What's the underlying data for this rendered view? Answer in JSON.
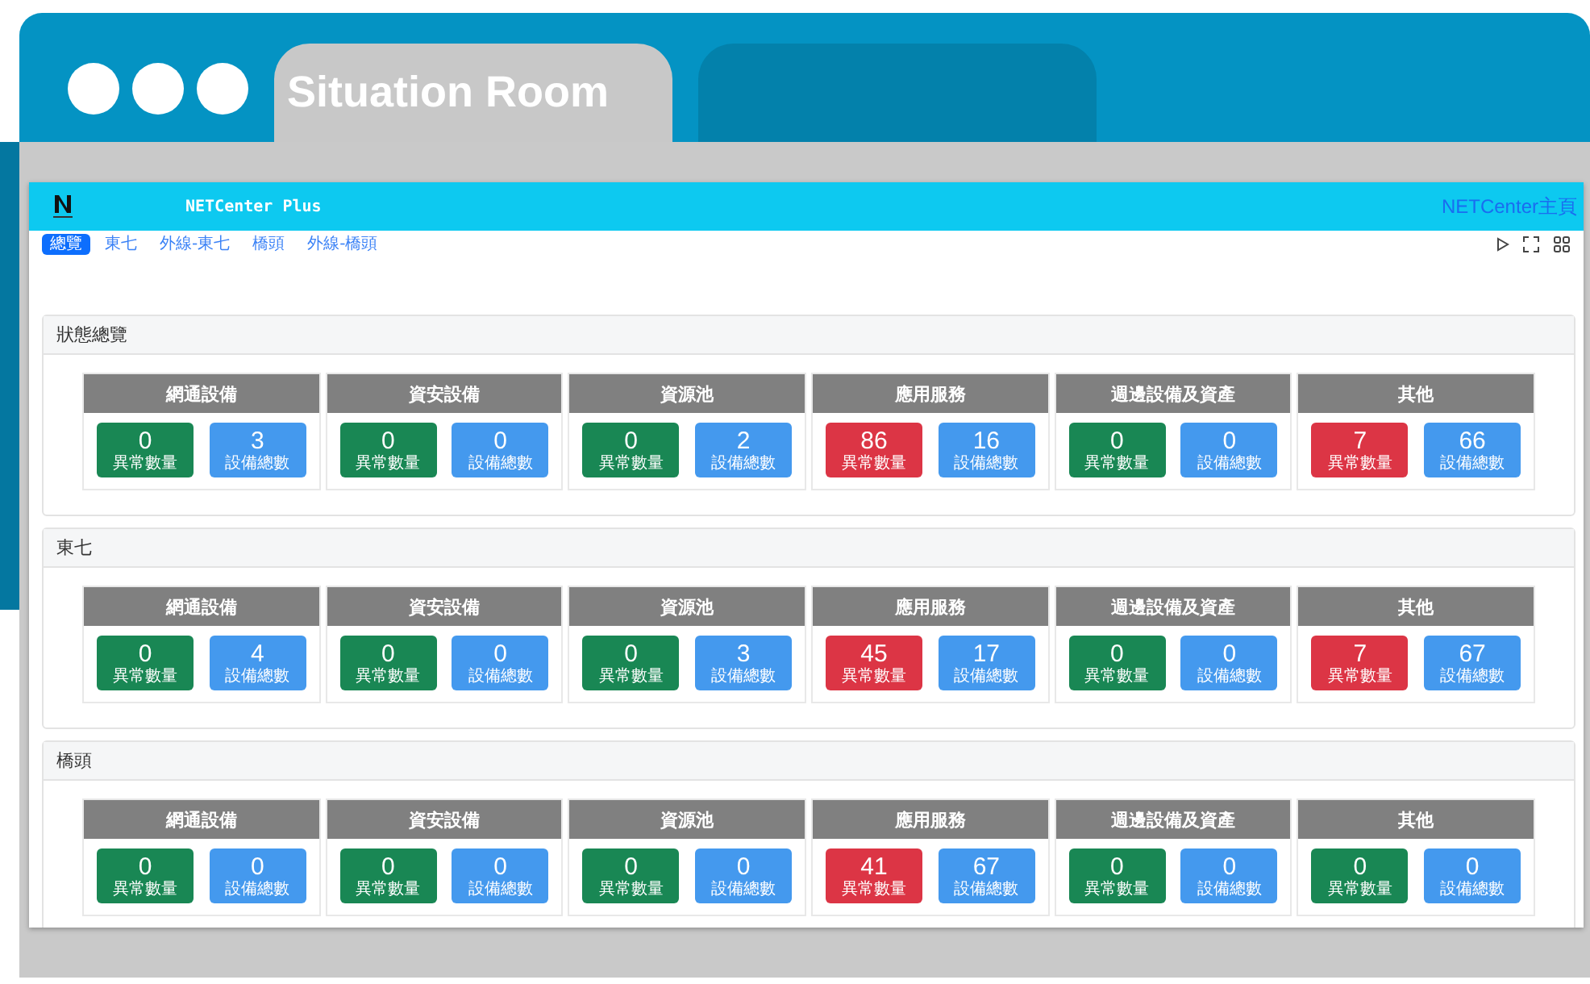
{
  "window": {
    "tabs": [
      {
        "label": "Situation Room",
        "selected": true
      },
      {
        "selected": false
      }
    ]
  },
  "app": {
    "title": "NETCenter Plus",
    "home_link": "NETCenter主頁"
  },
  "nav": [
    {
      "label": "總覽",
      "selected": true
    },
    {
      "label": "東七",
      "selected": false
    },
    {
      "label": "外線-東七",
      "selected": false
    },
    {
      "label": "橋頭",
      "selected": false
    },
    {
      "label": "外線-橋頭",
      "selected": false
    }
  ],
  "sections": [
    {
      "title": "狀態總覽",
      "groups": [
        {
          "name": "網通設備",
          "anomaly": "0",
          "alert": false,
          "anomaly_label": "異常數量",
          "total": "3",
          "total_label": "設備總數"
        },
        {
          "name": "資安設備",
          "anomaly": "0",
          "alert": false,
          "anomaly_label": "異常數量",
          "total": "0",
          "total_label": "設備總數"
        },
        {
          "name": "資源池",
          "anomaly": "0",
          "alert": false,
          "anomaly_label": "異常數量",
          "total": "2",
          "total_label": "設備總數"
        },
        {
          "name": "應用服務",
          "anomaly": "86",
          "alert": true,
          "anomaly_label": "異常數量",
          "total": "16",
          "total_label": "設備總數"
        },
        {
          "name": "週邊設備及資產",
          "anomaly": "0",
          "alert": false,
          "anomaly_label": "異常數量",
          "total": "0",
          "total_label": "設備總數"
        },
        {
          "name": "其他",
          "anomaly": "7",
          "alert": true,
          "anomaly_label": "異常數量",
          "total": "66",
          "total_label": "設備總數"
        }
      ]
    },
    {
      "title": "東七",
      "groups": [
        {
          "name": "網通設備",
          "anomaly": "0",
          "alert": false,
          "anomaly_label": "異常數量",
          "total": "4",
          "total_label": "設備總數"
        },
        {
          "name": "資安設備",
          "anomaly": "0",
          "alert": false,
          "anomaly_label": "異常數量",
          "total": "0",
          "total_label": "設備總數"
        },
        {
          "name": "資源池",
          "anomaly": "0",
          "alert": false,
          "anomaly_label": "異常數量",
          "total": "3",
          "total_label": "設備總數"
        },
        {
          "name": "應用服務",
          "anomaly": "45",
          "alert": true,
          "anomaly_label": "異常數量",
          "total": "17",
          "total_label": "設備總數"
        },
        {
          "name": "週邊設備及資產",
          "anomaly": "0",
          "alert": false,
          "anomaly_label": "異常數量",
          "total": "0",
          "total_label": "設備總數"
        },
        {
          "name": "其他",
          "anomaly": "7",
          "alert": true,
          "anomaly_label": "異常數量",
          "total": "67",
          "total_label": "設備總數"
        }
      ]
    },
    {
      "title": "橋頭",
      "groups": [
        {
          "name": "網通設備",
          "anomaly": "0",
          "alert": false,
          "anomaly_label": "異常數量",
          "total": "0",
          "total_label": "設備總數"
        },
        {
          "name": "資安設備",
          "anomaly": "0",
          "alert": false,
          "anomaly_label": "異常數量",
          "total": "0",
          "total_label": "設備總數"
        },
        {
          "name": "資源池",
          "anomaly": "0",
          "alert": false,
          "anomaly_label": "異常數量",
          "total": "0",
          "total_label": "設備總數"
        },
        {
          "name": "應用服務",
          "anomaly": "41",
          "alert": true,
          "anomaly_label": "異常數量",
          "total": "67",
          "total_label": "設備總數"
        },
        {
          "name": "週邊設備及資產",
          "anomaly": "0",
          "alert": false,
          "anomaly_label": "異常數量",
          "total": "0",
          "total_label": "設備總數"
        },
        {
          "name": "其他",
          "anomaly": "0",
          "alert": false,
          "anomaly_label": "異常數量",
          "total": "0",
          "total_label": "設備總數"
        }
      ]
    }
  ]
}
